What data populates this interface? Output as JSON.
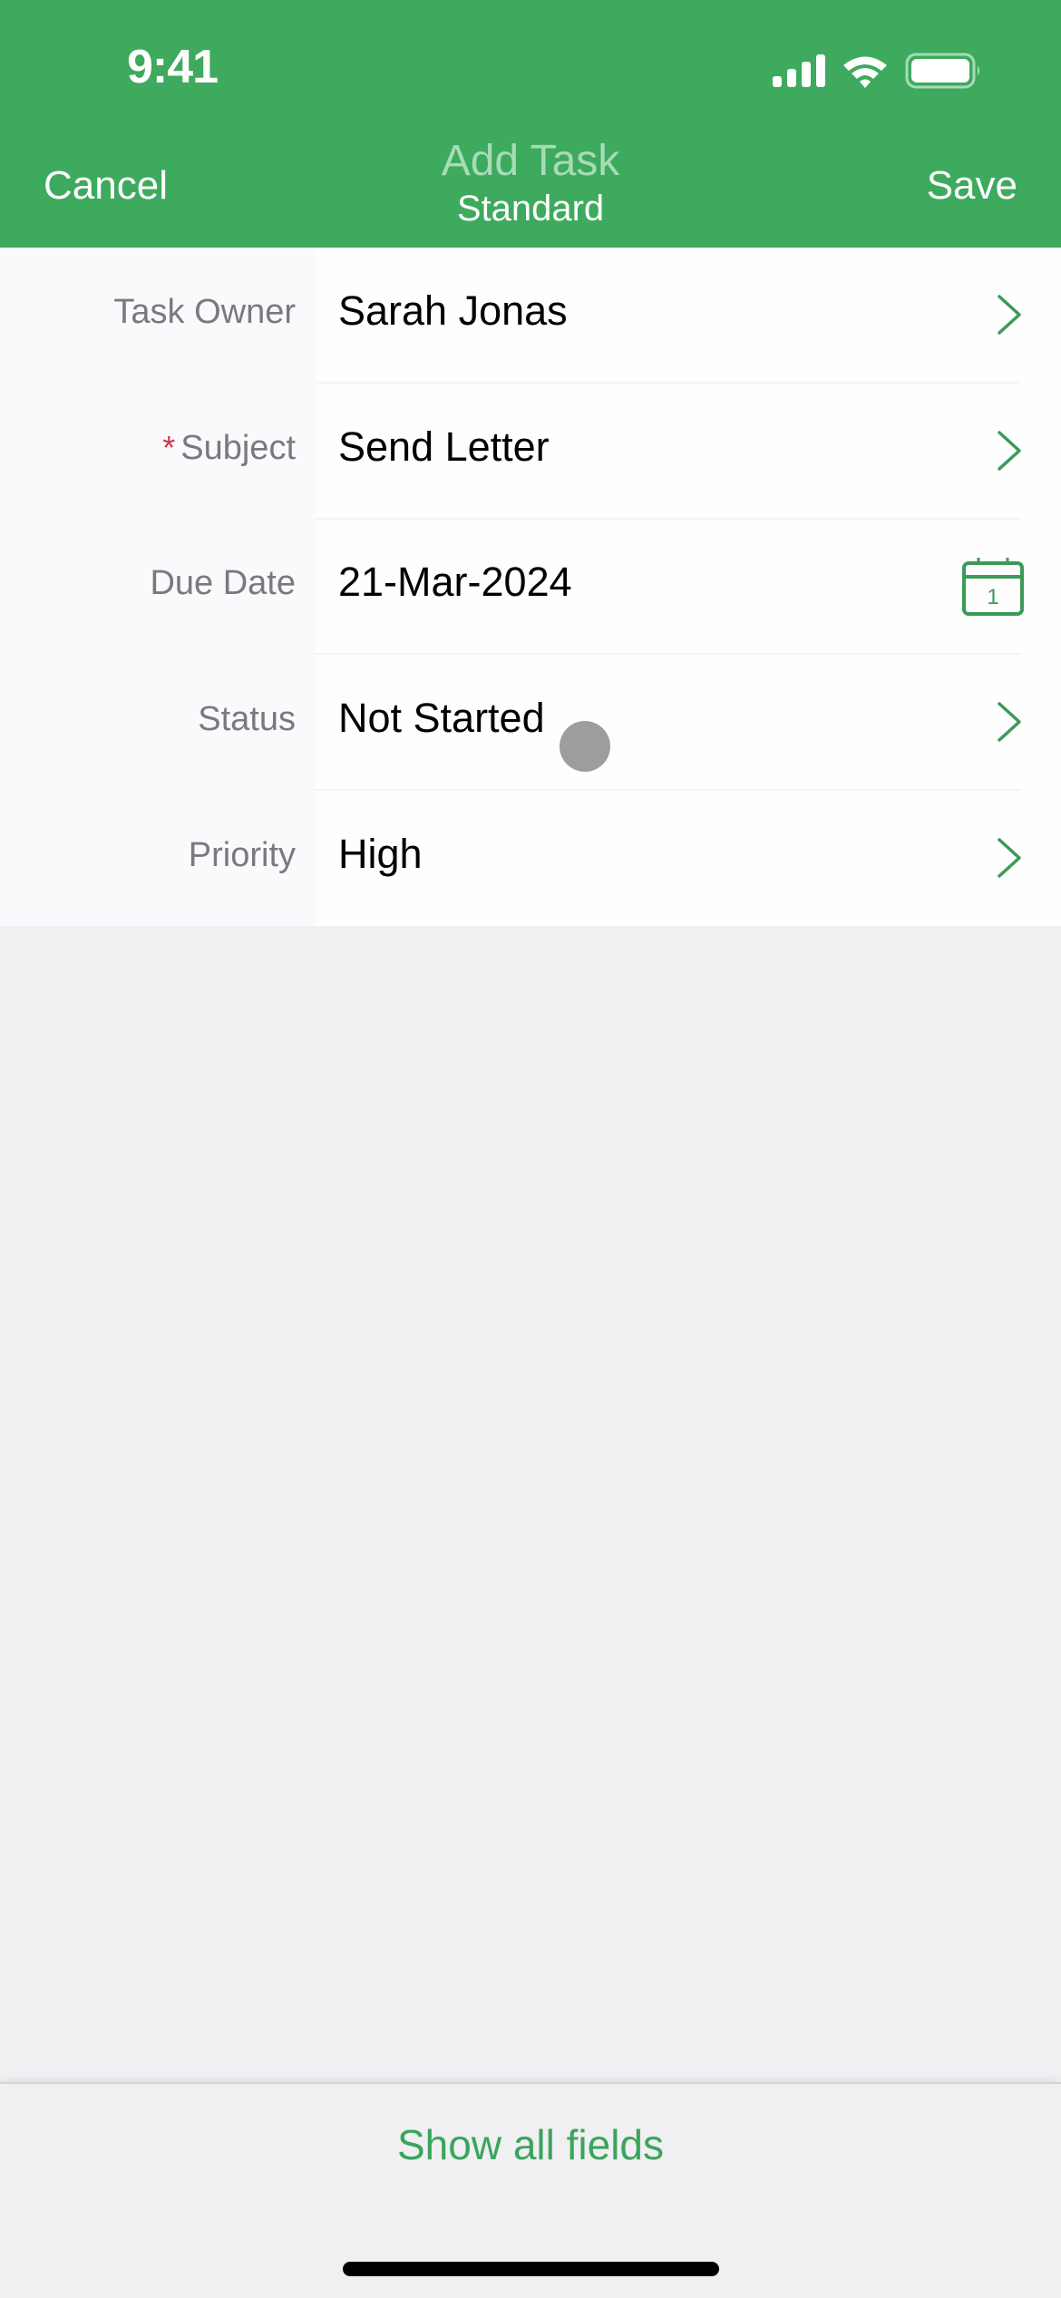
{
  "status_bar": {
    "time": "9:41",
    "icons": [
      "cellular-signal-icon",
      "wifi-icon",
      "battery-icon"
    ]
  },
  "nav": {
    "cancel_label": "Cancel",
    "title": "Add Task",
    "subtitle": "Standard",
    "save_label": "Save"
  },
  "form": {
    "fields": [
      {
        "label": "Task Owner",
        "value": "Sarah Jonas",
        "required": false,
        "accessory": "chevron-right-icon"
      },
      {
        "label": "Subject",
        "value": "Send Letter",
        "required": true,
        "required_marker": "*",
        "accessory": "chevron-right-icon"
      },
      {
        "label": "Due Date",
        "value": "21-Mar-2024",
        "required": false,
        "accessory": "calendar-icon",
        "calendar_day": "1"
      },
      {
        "label": "Status",
        "value": "Not Started",
        "required": false,
        "accessory": "chevron-right-icon"
      },
      {
        "label": "Priority",
        "value": "High",
        "required": false,
        "accessory": "chevron-right-icon"
      }
    ]
  },
  "footer": {
    "show_all_label": "Show all fields"
  },
  "colors": {
    "brand_green": "#3daa5e",
    "title_faded": "#a6dcb6",
    "required_red": "#c9384d",
    "label_gray": "#7a797e",
    "link_green": "#3aa55c",
    "background": "#f0eff2"
  }
}
